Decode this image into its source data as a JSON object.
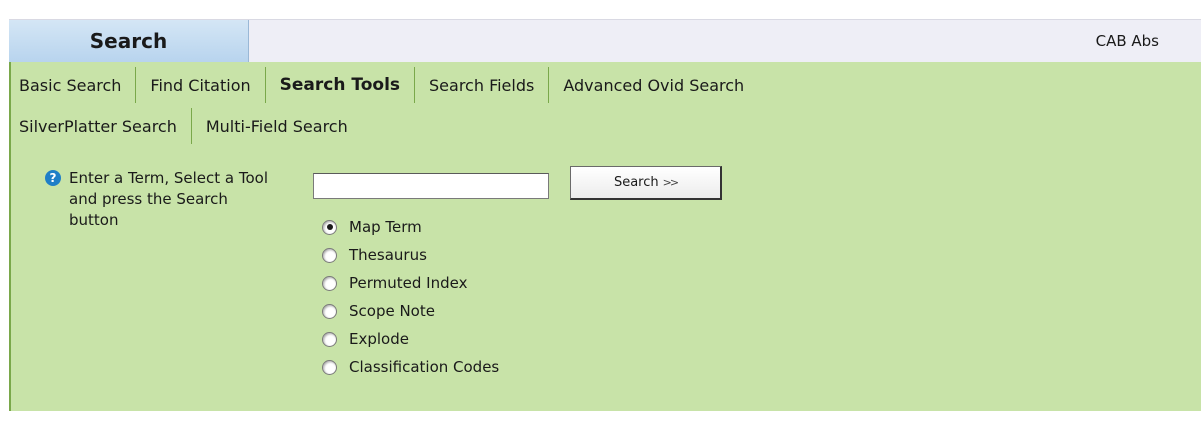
{
  "header": {
    "title": "Search",
    "database": "CAB Abs"
  },
  "tabs": {
    "row1": [
      {
        "label": "Basic Search"
      },
      {
        "label": "Find Citation"
      },
      {
        "label": "Search Tools",
        "active": true
      },
      {
        "label": "Search Fields"
      },
      {
        "label": "Advanced Ovid Search"
      }
    ],
    "row2": [
      {
        "label": "SilverPlatter Search"
      },
      {
        "label": "Multi-Field Search"
      }
    ]
  },
  "help": {
    "icon": "question-icon",
    "text": "Enter a Term, Select a Tool and press the Search button"
  },
  "search": {
    "term_value": "",
    "button_label": "Search",
    "button_icon": "double-chevron-right"
  },
  "tools": [
    {
      "label": "Map Term",
      "selected": true
    },
    {
      "label": "Thesaurus",
      "selected": false
    },
    {
      "label": "Permuted Index",
      "selected": false
    },
    {
      "label": "Scope Note",
      "selected": false
    },
    {
      "label": "Explode",
      "selected": false
    },
    {
      "label": "Classification Codes",
      "selected": false
    }
  ],
  "colors": {
    "panel_green": "#c8e3a8",
    "panel_border": "#7aa84a",
    "header_tab_blue": "#b8d4ee",
    "help_icon_blue": "#1f7fc7"
  }
}
